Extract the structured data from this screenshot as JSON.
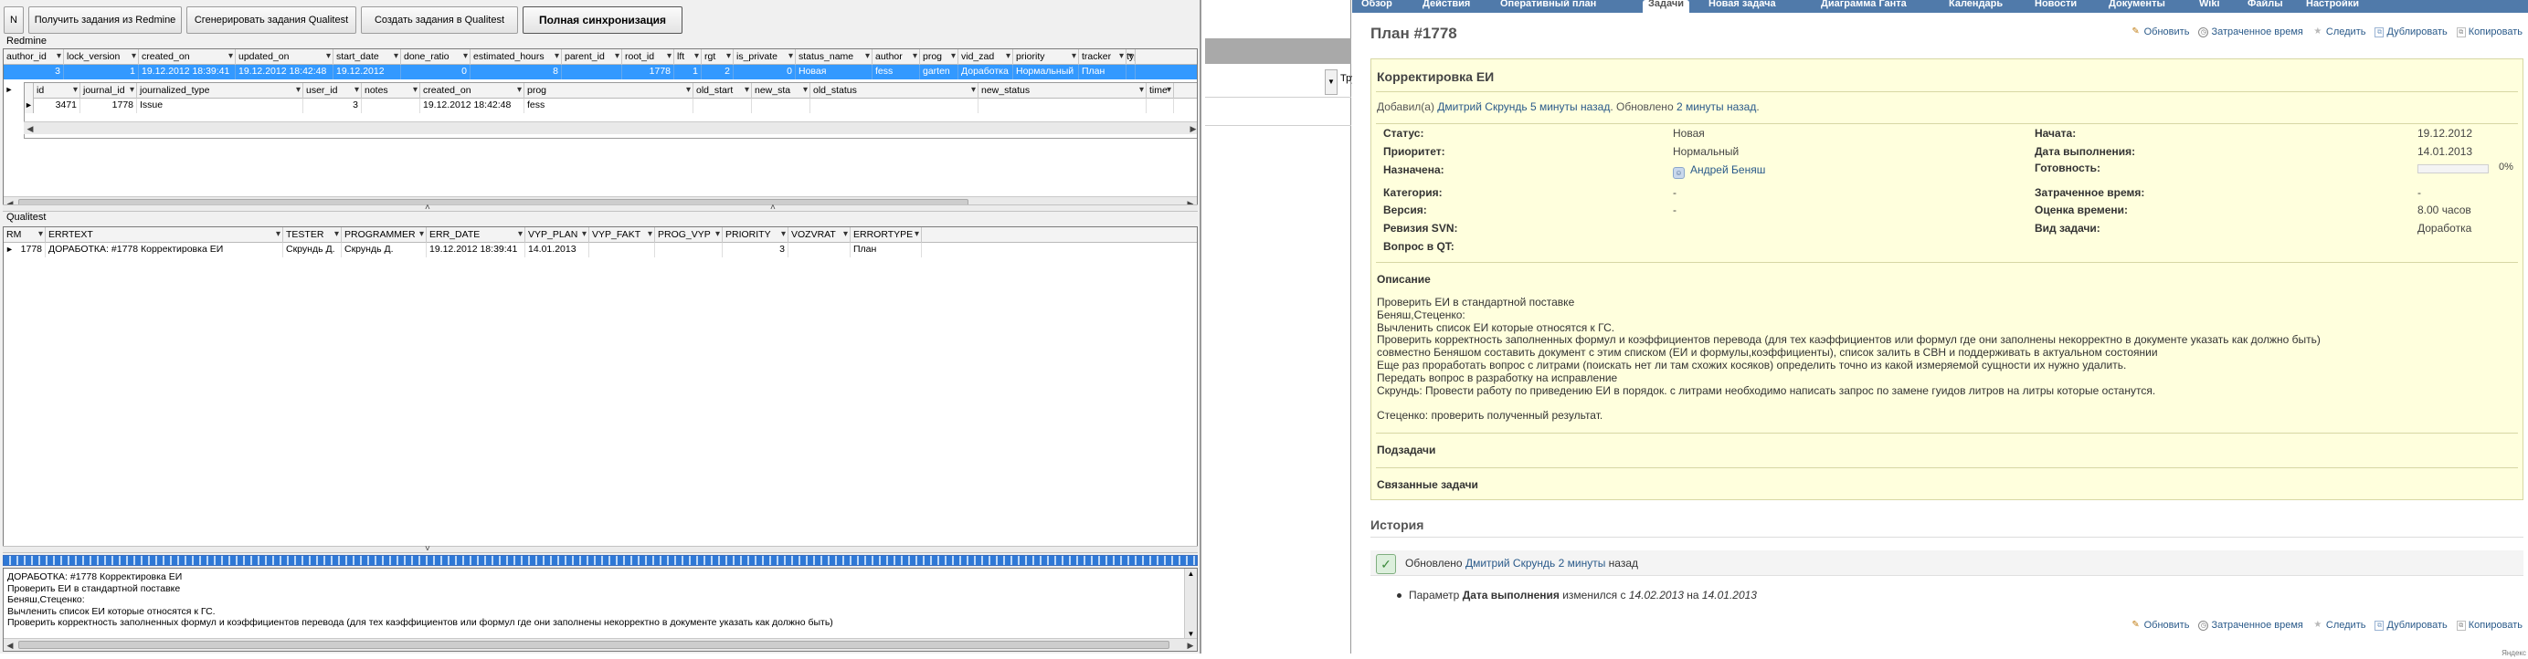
{
  "toolbar": {
    "n_button": "N",
    "get_redmine": "Получить задания из Redmine",
    "generate_qualitest": "Сгенерировать задания Qualitest",
    "create_qualitest": "Создать задания в Qualitest",
    "full_sync": "Полная синхронизация"
  },
  "redmine_section": {
    "label": "Redmine",
    "columns": [
      "author_id",
      "lock_version",
      "created_on",
      "updated_on",
      "start_date",
      "done_ratio",
      "estimated_hours",
      "parent_id",
      "root_id",
      "lft",
      "rgt",
      "is_private",
      "status_name",
      "author",
      "prog",
      "vid_zad",
      "priority",
      "tracker",
      "type"
    ],
    "row": [
      "3",
      "1",
      "19.12.2012 18:39:41",
      "19.12.2012 18:42:48",
      "19.12.2012",
      "0",
      "8",
      "",
      "1778",
      "1",
      "2",
      "0",
      "Новая",
      "fess",
      "garten",
      "Доработка",
      "Нормальный",
      "План",
      ""
    ],
    "sub_columns": [
      "id",
      "journal_id",
      "journalized_type",
      "user_id",
      "notes",
      "created_on",
      "prog",
      "old_start",
      "new_sta",
      "old_status",
      "new_status",
      "time"
    ],
    "sub_row": [
      "3471",
      "1778",
      "Issue",
      "3",
      "",
      "19.12.2012 18:42:48",
      "fess",
      "",
      "",
      "",
      "",
      ""
    ]
  },
  "qualitest_section": {
    "label": "Qualitest",
    "columns": [
      "RM",
      "ERRTEXT",
      "TESTER",
      "PROGRAMMER",
      "ERR_DATE",
      "VYP_PLAN",
      "VYP_FAKT",
      "PROG_VYP",
      "PRIORITY",
      "VOZVRAT",
      "ERRORTYPE"
    ],
    "row": [
      "1778",
      "ДОРАБОТКА: #1778 Корректировка ЕИ",
      "Скрундь Д.",
      "Скрундь Д.",
      "19.12.2012 18:39:41",
      "14.01.2013",
      "",
      "",
      "3",
      "",
      "План"
    ]
  },
  "text_area": {
    "lines": [
      "ДОРАБОТКА: #1778 Корректировка ЕИ",
      "Проверить ЕИ в стандартной поставке",
      "Беняш,Стеценко:",
      "Вычленить список ЕИ которые относятся к ГС.",
      "Проверить корректность заполненных формул и коэффициентов перевода (для тех каэффициентов или формул где они заполнены некорректно в документе указать как должно быть)"
    ]
  },
  "middle": {
    "label": "Тру"
  },
  "redmine_page": {
    "nav_tabs": [
      "Обзор",
      "Действия",
      "Оперативный план",
      "Задачи",
      "Новая задача",
      "Диаграмма Ганта",
      "Календарь",
      "Новости",
      "Документы",
      "Wiki",
      "Файлы",
      "Настройки"
    ],
    "title": "План #1778",
    "actions": {
      "update": "Обновить",
      "spent_time": "Затраченное время",
      "watch": "Следить",
      "duplicate": "Дублировать",
      "copy": "Копировать"
    },
    "subject": "Корректировка ЕИ",
    "author_line": {
      "prefix": "Добавил(а)",
      "author": "Дмитрий Скрундь",
      "created_ago": "5 минуты назад",
      "updated_text": ". Обновлено",
      "updated_ago": "2 минуты назад",
      "end": "."
    },
    "attributes_left": [
      {
        "label": "Статус:",
        "value": "Новая"
      },
      {
        "label": "Приоритет:",
        "value": "Нормальный"
      },
      {
        "label": "Назначена:",
        "value": "Андрей Беняш"
      },
      {
        "label": "Категория:",
        "value": "-"
      },
      {
        "label": "Версия:",
        "value": "-"
      },
      {
        "label": "Ревизия SVN:",
        "value": ""
      },
      {
        "label": "Вопрос в QT:",
        "value": ""
      }
    ],
    "attributes_right": [
      {
        "label": "Начата:",
        "value": "19.12.2012"
      },
      {
        "label": "Дата выполнения:",
        "value": "14.01.2013"
      },
      {
        "label": "Готовность:",
        "value": "0%"
      },
      {
        "label": "Затраченное время:",
        "value": "-"
      },
      {
        "label": "Оценка времени:",
        "value": "8.00 часов"
      },
      {
        "label": "Вид задачи:",
        "value": "Доработка"
      }
    ],
    "done_ratio": 0,
    "description_heading": "Описание",
    "description_lines": [
      "Проверить ЕИ в стандартной поставке",
      "Беняш,Стеценко:",
      "Вычленить список ЕИ которые относятся к ГС.",
      "Проверить корректность заполненных формул и коэффициентов перевода (для тех каэффициентов или формул где они заполнены некорректно в документе указать как должно быть)",
      "совместно Беняшом составить документ с этим списком (ЕИ и формулы,коэффициенты), список залить в СВН и поддерживать в актуальном состоянии",
      "Еще раз проработать вопрос с литрами (поискать нет ли там схожих косяков) определить точно из какой измеряемой сущности их нужно удалить.",
      "Передать вопрос в разработку на исправление",
      "Скрундь: Провести работу по приведению ЕИ в порядок. с литрами необходимо написать запрос по замене гуидов литров на литры которые останутся.",
      "",
      "Стеценко: проверить полученный результат."
    ],
    "subtasks_heading": "Подзадачи",
    "related_heading": "Связанные задачи",
    "history_heading": "История",
    "journal": {
      "prefix": "Обновлено",
      "author": "Дмитрий Скрундь",
      "ago": "2 минуты",
      "suffix": "назад"
    },
    "journal_detail": {
      "prefix": "Параметр",
      "field": "Дата выполнения",
      "changed": "изменился с",
      "old_value": "14.02.2013",
      "to": "на",
      "new_value": "14.01.2013"
    },
    "credit": "Яндекс"
  },
  "colors": {
    "selection": "#3399ff",
    "nav_bar": "#507aaa",
    "issue_bg": "#ffffdd",
    "link": "#2a5a8a"
  }
}
